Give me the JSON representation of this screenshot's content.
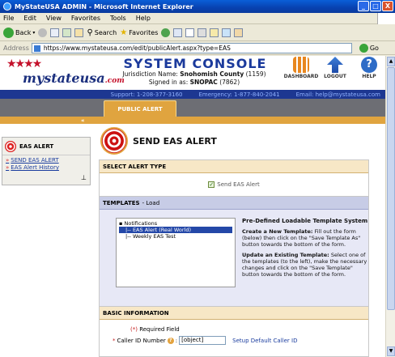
{
  "window": {
    "title": "MyStateUSA ADMIN - Microsoft Internet Explorer",
    "min": "_",
    "max": "□",
    "close": "X"
  },
  "menu": [
    "File",
    "Edit",
    "View",
    "Favorites",
    "Tools",
    "Help"
  ],
  "toolbar": {
    "back": "Back",
    "search": "Search",
    "favorites": "Favorites"
  },
  "address": {
    "label": "Address",
    "url": "https://www.mystateusa.com/edit/publicAlert.aspx?type=EAS",
    "go": "Go"
  },
  "header": {
    "logo_text": "mystateusa",
    "logo_suffix": ".com",
    "console_title": "SYSTEM CONSOLE",
    "jurisdiction_label": "Jurisdiction Name:",
    "jurisdiction_value": "Snohomish County",
    "jurisdiction_id": "(1159)",
    "signed_label": "Signed in as:",
    "signed_value": "SNOPAC",
    "signed_id": "(7862)",
    "icons": {
      "dashboard": "DASHBOARD",
      "logout": "LOGOUT",
      "help": "HELP"
    }
  },
  "supportbar": {
    "support": "Support: 1-208-377-3160",
    "emergency": "Emergency: 1-877-840-2041",
    "email": "Email: help@mystateusa.com"
  },
  "tab": {
    "label": "PUBLIC ALERT",
    "collapse": "«"
  },
  "sidebar": {
    "title": "EAS ALERT",
    "links": [
      "SEND EAS ALERT",
      "EAS Alert History"
    ]
  },
  "main": {
    "title": "SEND EAS ALERT",
    "select_type": {
      "header": "SELECT ALERT TYPE",
      "checkbox_label": "Send EAS Alert",
      "checked": true
    },
    "templates": {
      "header": "TEMPLATES",
      "load": "- Load",
      "tree": [
        "Notifications",
        "|-- EAS Alert (Real World)",
        "|-- Weekly EAS Test"
      ],
      "info_title": "Pre-Defined Loadable Template System",
      "create_bold": "Create a New Template:",
      "create_text": "Fill out the form (below) then click on the \"Save Template As\" button towards the bottom of the form.",
      "update_bold": "Update an Existing Template:",
      "update_text": "Select one of the templates (to the left), make the necessary changes and click on the \"Save Template\" button towards the bottom of the form."
    },
    "basic": {
      "header": "BASIC INFORMATION",
      "required_mark": "(*)",
      "required_text": "Required Field",
      "caller_star": "*",
      "caller_label": "Caller ID Number",
      "caller_help": "?",
      "caller_colon": ":",
      "caller_value": "[object]",
      "set_default": "Setup Default Caller ID"
    }
  }
}
